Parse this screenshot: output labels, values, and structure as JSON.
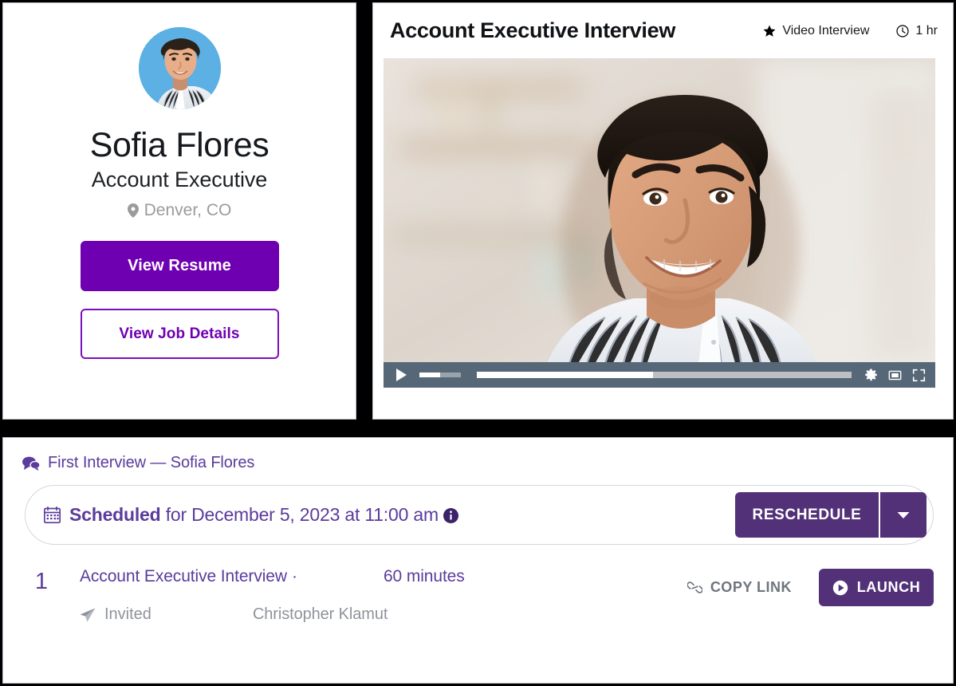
{
  "profile": {
    "avatar_alt": "Sofia Flores headshot",
    "name": "Sofia Flores",
    "title": "Account Executive",
    "location": "Denver, CO",
    "view_resume_label": "View Resume",
    "view_job_details_label": "View Job Details"
  },
  "interview_panel": {
    "title": "Account Executive Interview",
    "type_label": "Video Interview",
    "duration_label": "1 hr",
    "video": {
      "progress_percent": 47,
      "volume_percent": 50
    }
  },
  "section": {
    "header": "First Interview — Sofia Flores",
    "schedule": {
      "status_bold": "Scheduled",
      "status_rest": " for December 5, 2023 at 11:00 am",
      "reschedule_label": "RESCHEDULE"
    },
    "interviews": [
      {
        "index": "1",
        "name": "Account Executive Interview",
        "separator": "·",
        "duration": "60 minutes",
        "status": "Invited",
        "person": "Christopher Klamut",
        "copy_link_label": "COPY LINK",
        "launch_label": "LAUNCH"
      }
    ]
  },
  "colors": {
    "brand_purple": "#6f00b2",
    "muted_purple": "#533178",
    "text_purple": "#5b3b9c",
    "gray_text": "#8e939b",
    "video_bar": "#566877",
    "avatar_bg": "#5cb0e4"
  }
}
